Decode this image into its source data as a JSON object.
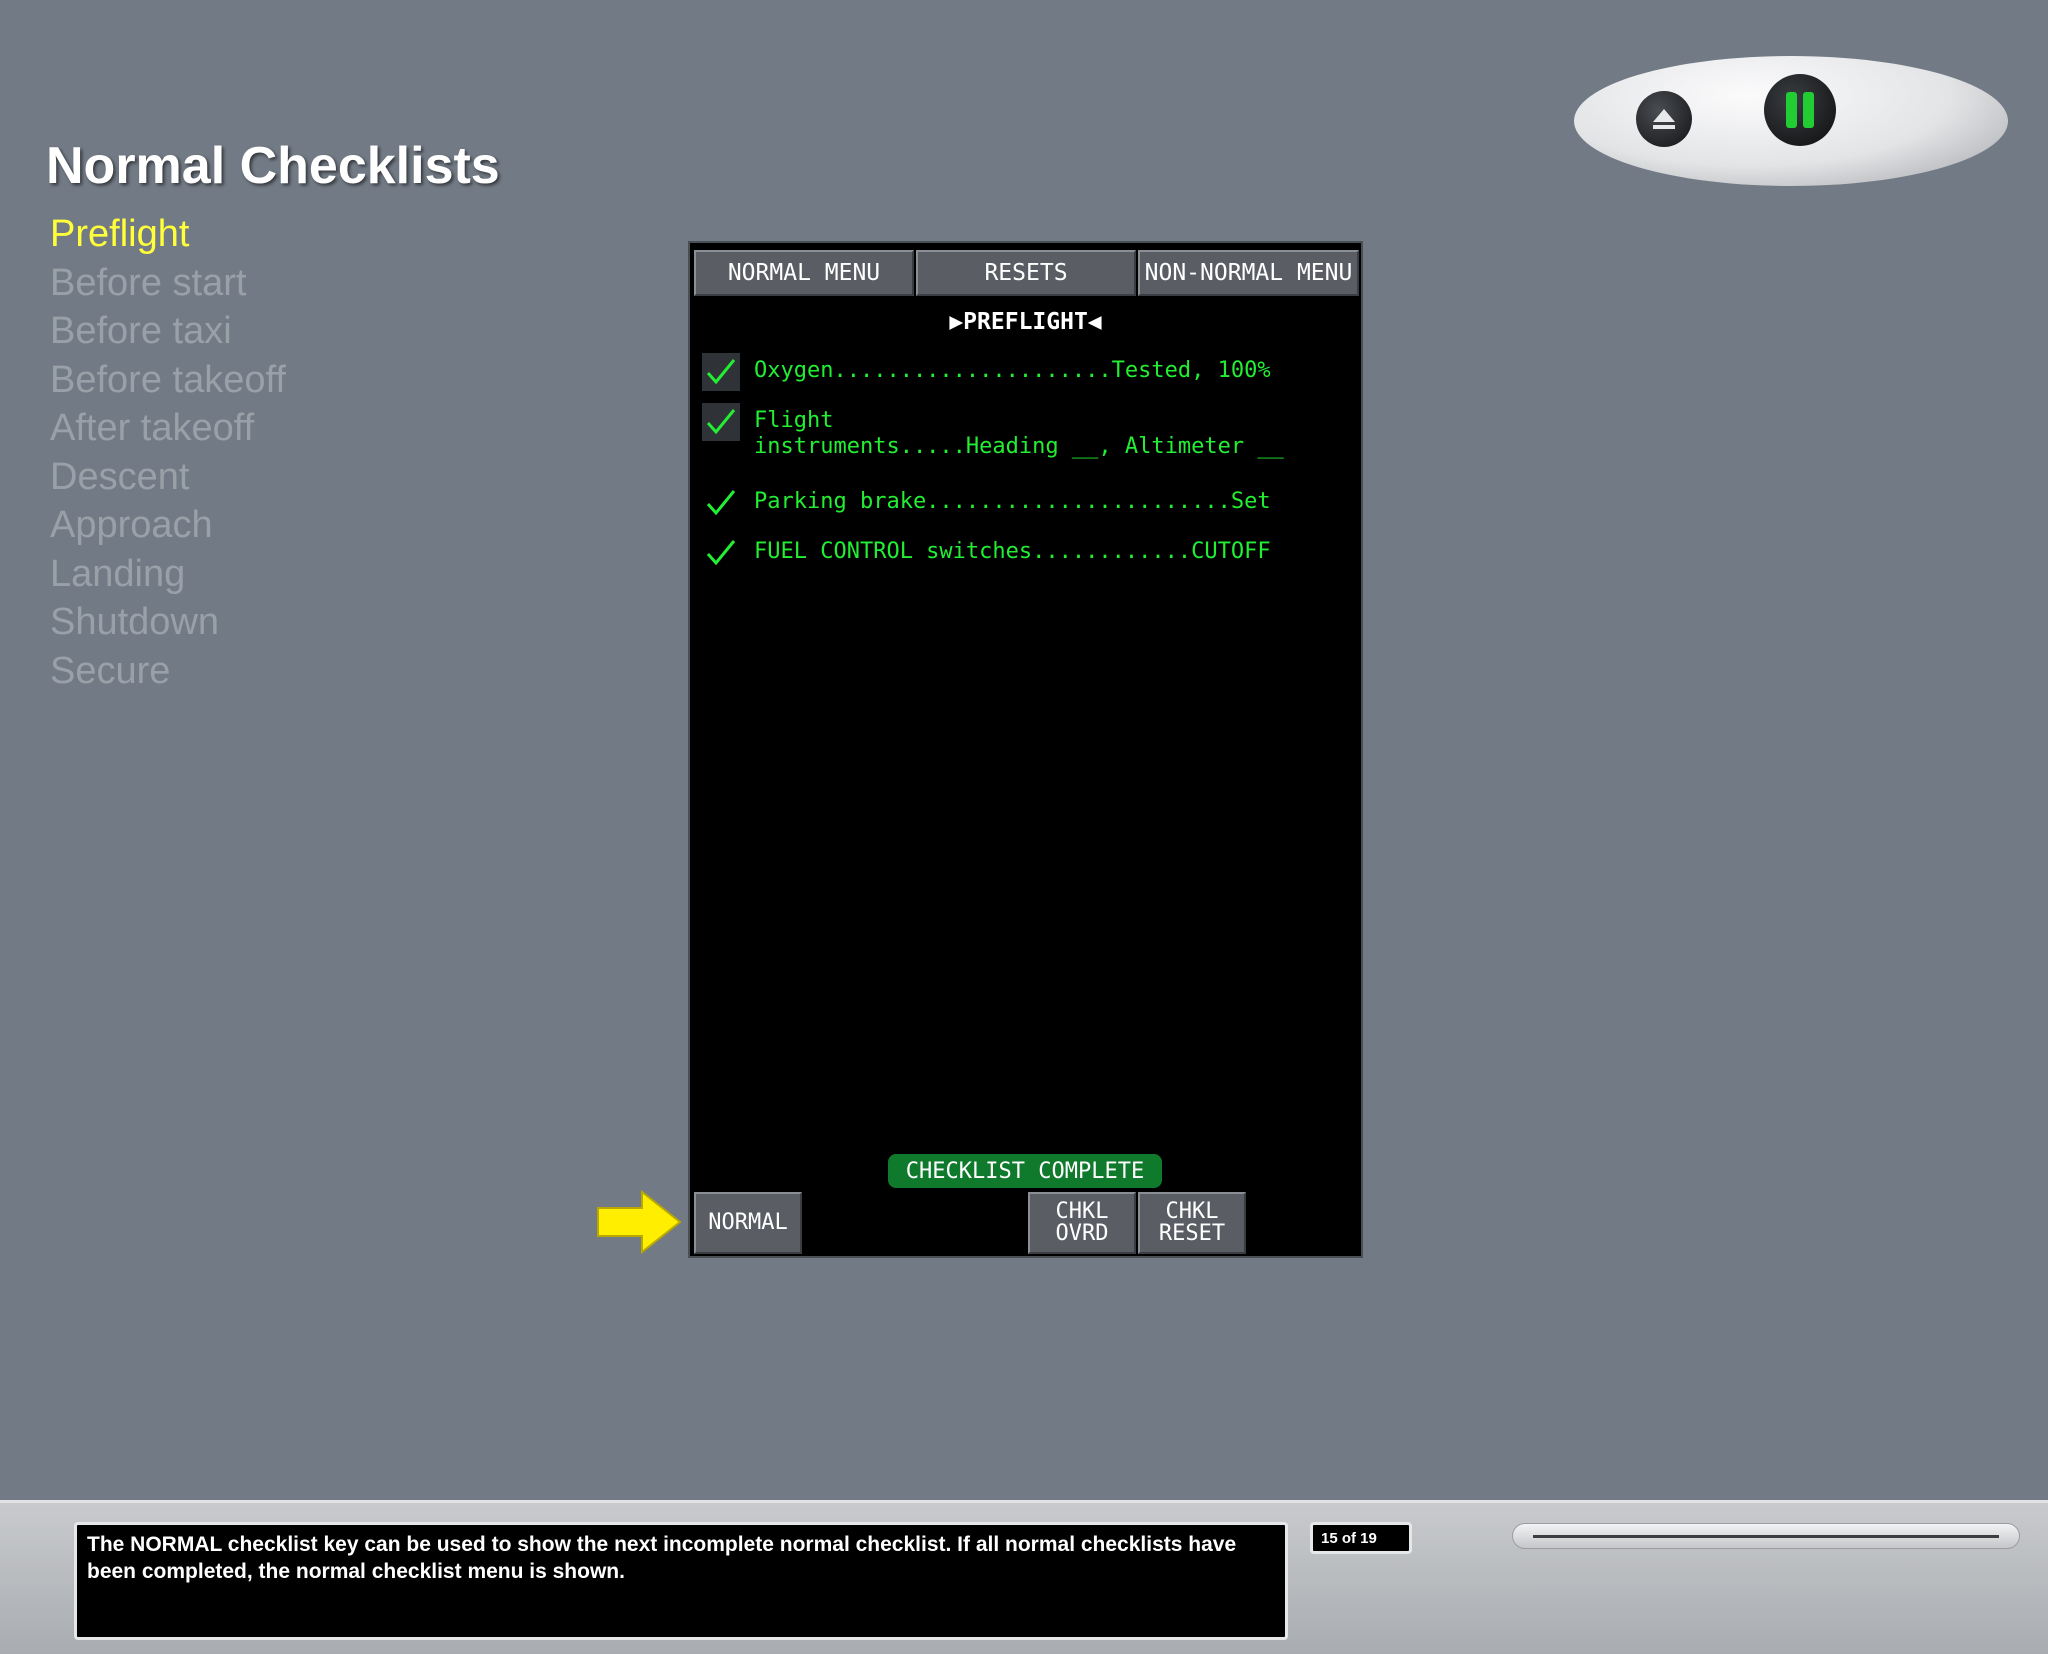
{
  "page": {
    "title": "Normal Checklists"
  },
  "nav": {
    "items": [
      {
        "label": "Preflight",
        "active": true
      },
      {
        "label": "Before start",
        "active": false
      },
      {
        "label": "Before taxi",
        "active": false
      },
      {
        "label": "Before takeoff",
        "active": false
      },
      {
        "label": "After takeoff",
        "active": false
      },
      {
        "label": "Descent",
        "active": false
      },
      {
        "label": "Approach",
        "active": false
      },
      {
        "label": "Landing",
        "active": false
      },
      {
        "label": "Shutdown",
        "active": false
      },
      {
        "label": "Secure",
        "active": false
      }
    ],
    "active_color": "#ffff3a",
    "inactive_color": "#9aa0a8"
  },
  "display": {
    "top_buttons": {
      "normal_menu": "NORMAL MENU",
      "resets": "RESETS",
      "non_normal_menu": "NON-NORMAL MENU"
    },
    "checklist_title": "▶PREFLIGHT◀",
    "items": [
      {
        "text": "Oxygen.....................Tested, 100%",
        "checked": true,
        "boxed": true
      },
      {
        "text": "Flight\ninstruments.....Heading __, Altimeter __",
        "checked": true,
        "boxed": true
      },
      {
        "text": "Parking brake.......................Set",
        "checked": true,
        "boxed": false
      },
      {
        "text": "FUEL CONTROL switches............CUTOFF",
        "checked": true,
        "boxed": false
      }
    ],
    "complete_label": "CHECKLIST COMPLETE",
    "bottom_buttons": {
      "normal": "NORMAL",
      "chkl_ovrd": "CHKL\nOVRD",
      "chkl_reset": "CHKL\nRESET"
    },
    "text_color": "#22ee33",
    "complete_color": "#0f7a2c"
  },
  "pointer": {
    "icon": "arrow-right-icon",
    "color": "#ffee00"
  },
  "footer": {
    "caption": "The NORMAL checklist key can be used to show the next incomplete normal checklist. If all normal checklists have been completed, the normal checklist menu is shown.",
    "page_counter": "15 of 19",
    "controls": {
      "eject_icon": "eject-icon",
      "pause_icon": "pause-icon",
      "pause_color": "#22cc33"
    }
  }
}
